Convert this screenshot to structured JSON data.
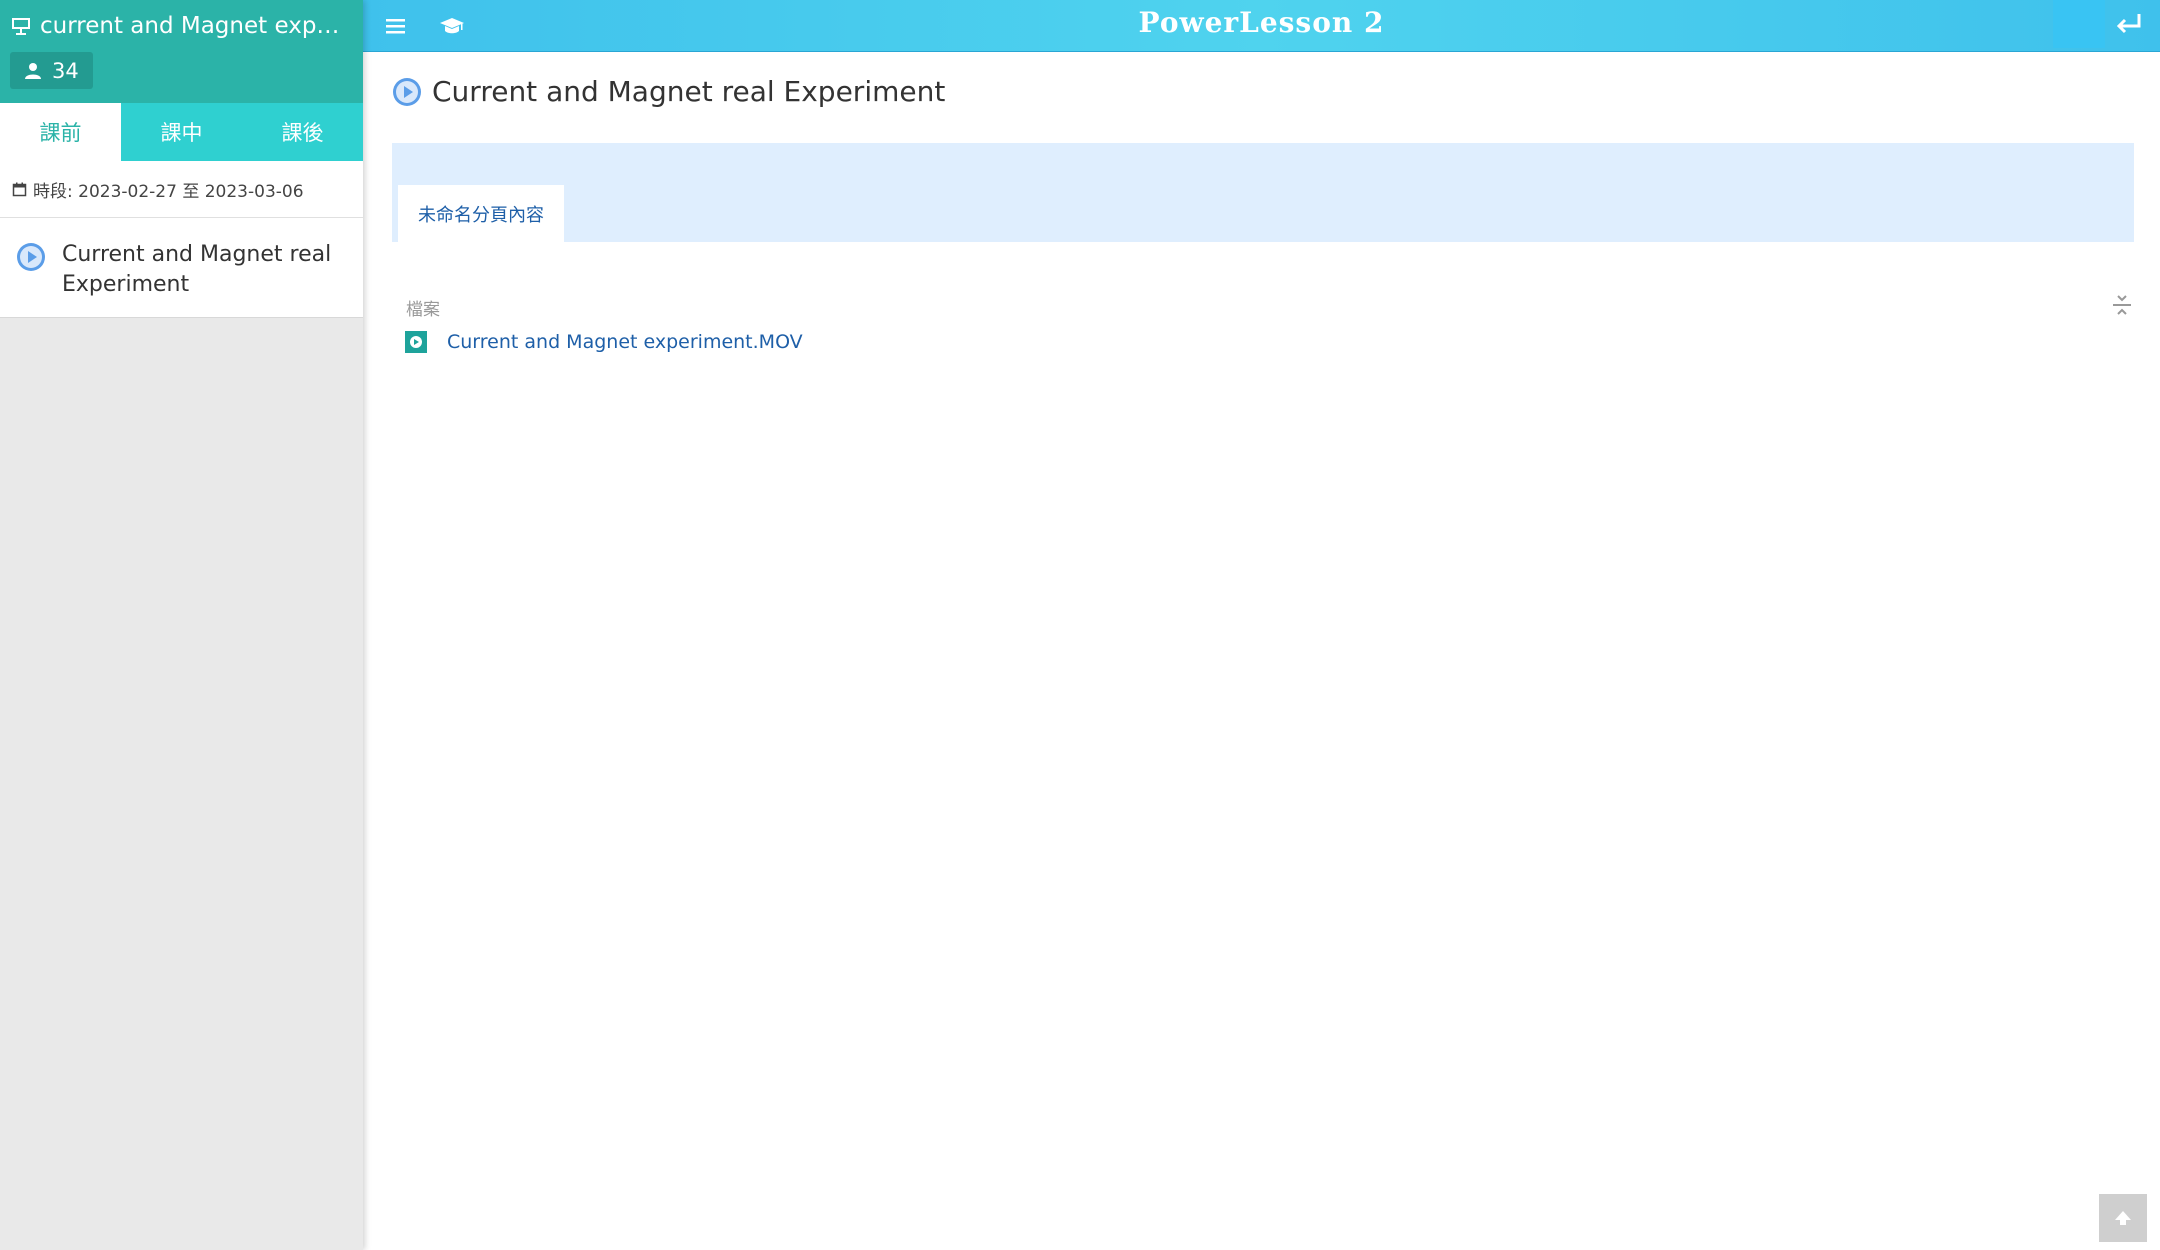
{
  "sidebar": {
    "course_title": "current and Magnet experi...",
    "member_count": "34",
    "tabs": [
      {
        "label": "課前",
        "active": true
      },
      {
        "label": "課中",
        "active": false
      },
      {
        "label": "課後",
        "active": false
      }
    ],
    "period_text": "時段: 2023-02-27 至 2023-03-06",
    "items": [
      {
        "label": "Current and Magnet real Experiment",
        "icon": "play-circle-icon"
      }
    ]
  },
  "topbar": {
    "logo": "PowerLesson 2",
    "icons": [
      "menu-icon",
      "graduation-cap-icon",
      "logout-icon"
    ]
  },
  "main": {
    "heading": "Current and Magnet real Experiment",
    "content_tab": "未命名分頁內容",
    "files_label": "檔案",
    "files": [
      {
        "name": "Current and Magnet experiment.MOV",
        "icon": "video-file-icon"
      }
    ]
  },
  "colors": {
    "sidebar_header": "#2bb3a8",
    "sidebar_tabs": "#2fd0d0",
    "topbar": "#4fd3ee",
    "tab_strip": "#dfeefe",
    "link": "#1e5fa8",
    "play_icon": "#5b9de8"
  }
}
